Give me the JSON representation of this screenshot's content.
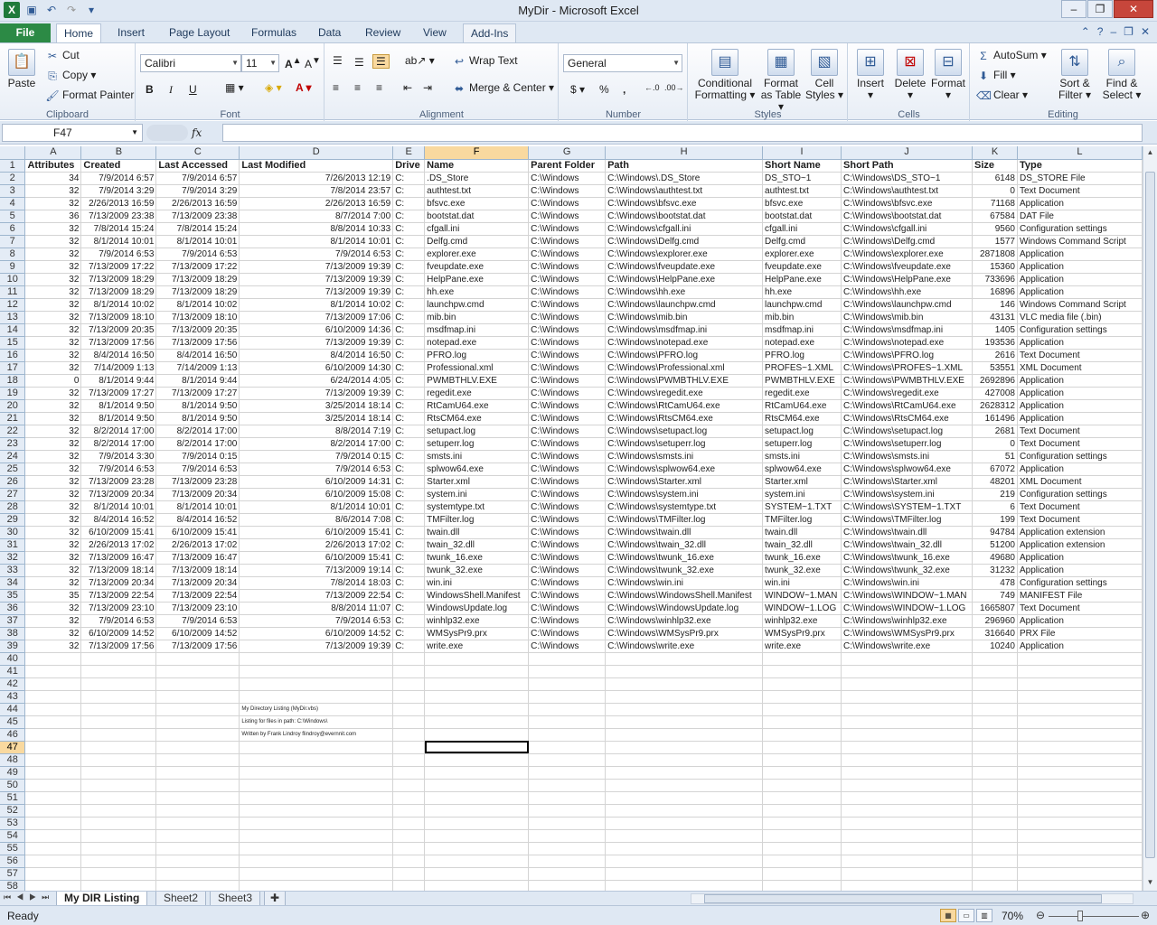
{
  "window": {
    "title": "MyDir  -  Microsoft Excel"
  },
  "ribbon_tabs": [
    "File",
    "Home",
    "Insert",
    "Page Layout",
    "Formulas",
    "Data",
    "Review",
    "View",
    "Add-Ins"
  ],
  "clipboard": {
    "paste": "Paste",
    "cut": "Cut",
    "copy": "Copy",
    "format_painter": "Format Painter",
    "label": "Clipboard"
  },
  "font": {
    "name": "Calibri",
    "size": "11",
    "bold": "B",
    "italic": "I",
    "underline": "U",
    "label": "Font"
  },
  "alignment": {
    "wrap_text": "Wrap Text",
    "merge_center": "Merge & Center",
    "label": "Alignment"
  },
  "number": {
    "format": "General",
    "currency": "$",
    "percent": "%",
    "comma": ",",
    "label": "Number"
  },
  "styles": {
    "conditional": "Conditional",
    "conditional2": "Formatting",
    "format_as": "Format",
    "format_as2": "as Table",
    "cell_styles": "Cell",
    "cell_styles2": "Styles",
    "label": "Styles"
  },
  "cells": {
    "insert": "Insert",
    "delete": "Delete",
    "format": "Format",
    "label": "Cells"
  },
  "editing": {
    "autosum": "AutoSum",
    "fill": "Fill",
    "clear": "Clear",
    "sort": "Sort &",
    "sort2": "Filter",
    "find": "Find &",
    "find2": "Select",
    "label": "Editing"
  },
  "formula_bar": {
    "name_box": "F47",
    "fx": "fx",
    "content": ""
  },
  "columns": [
    "A",
    "B",
    "C",
    "D",
    "E",
    "F",
    "G",
    "H",
    "I",
    "J",
    "K",
    "L"
  ],
  "selected_column": "F",
  "selected_row": 47,
  "headers": [
    "Attributes",
    "Created",
    "Last Accessed",
    "Last Modified",
    "Drive",
    "Name",
    "Parent Folder",
    "Path",
    "Short Name",
    "Short Path",
    "Size",
    "Type"
  ],
  "rows": [
    [
      "34",
      "7/9/2014 6:57",
      "7/9/2014 6:57",
      "7/26/2013 12:19",
      "C:",
      ".DS_Store",
      "C:\\Windows",
      "C:\\Windows\\.DS_Store",
      "DS_STO~1",
      "C:\\Windows\\DS_STO~1",
      "6148",
      "DS_STORE File"
    ],
    [
      "32",
      "7/9/2014 3:29",
      "7/9/2014 3:29",
      "7/8/2014 23:57",
      "C:",
      "authtest.txt",
      "C:\\Windows",
      "C:\\Windows\\authtest.txt",
      "authtest.txt",
      "C:\\Windows\\authtest.txt",
      "0",
      "Text Document"
    ],
    [
      "32",
      "2/26/2013 16:59",
      "2/26/2013 16:59",
      "2/26/2013 16:59",
      "C:",
      "bfsvc.exe",
      "C:\\Windows",
      "C:\\Windows\\bfsvc.exe",
      "bfsvc.exe",
      "C:\\Windows\\bfsvc.exe",
      "71168",
      "Application"
    ],
    [
      "36",
      "7/13/2009 23:38",
      "7/13/2009 23:38",
      "8/7/2014 7:00",
      "C:",
      "bootstat.dat",
      "C:\\Windows",
      "C:\\Windows\\bootstat.dat",
      "bootstat.dat",
      "C:\\Windows\\bootstat.dat",
      "67584",
      "DAT File"
    ],
    [
      "32",
      "7/8/2014 15:24",
      "7/8/2014 15:24",
      "8/8/2014 10:33",
      "C:",
      "cfgall.ini",
      "C:\\Windows",
      "C:\\Windows\\cfgall.ini",
      "cfgall.ini",
      "C:\\Windows\\cfgall.ini",
      "9560",
      "Configuration settings"
    ],
    [
      "32",
      "8/1/2014 10:01",
      "8/1/2014 10:01",
      "8/1/2014 10:01",
      "C:",
      "Delfg.cmd",
      "C:\\Windows",
      "C:\\Windows\\Delfg.cmd",
      "Delfg.cmd",
      "C:\\Windows\\Delfg.cmd",
      "1577",
      "Windows Command Script"
    ],
    [
      "32",
      "7/9/2014 6:53",
      "7/9/2014 6:53",
      "7/9/2014 6:53",
      "C:",
      "explorer.exe",
      "C:\\Windows",
      "C:\\Windows\\explorer.exe",
      "explorer.exe",
      "C:\\Windows\\explorer.exe",
      "2871808",
      "Application"
    ],
    [
      "32",
      "7/13/2009 17:22",
      "7/13/2009 17:22",
      "7/13/2009 19:39",
      "C:",
      "fveupdate.exe",
      "C:\\Windows",
      "C:\\Windows\\fveupdate.exe",
      "fveupdate.exe",
      "C:\\Windows\\fveupdate.exe",
      "15360",
      "Application"
    ],
    [
      "32",
      "7/13/2009 18:29",
      "7/13/2009 18:29",
      "7/13/2009 19:39",
      "C:",
      "HelpPane.exe",
      "C:\\Windows",
      "C:\\Windows\\HelpPane.exe",
      "HelpPane.exe",
      "C:\\Windows\\HelpPane.exe",
      "733696",
      "Application"
    ],
    [
      "32",
      "7/13/2009 18:29",
      "7/13/2009 18:29",
      "7/13/2009 19:39",
      "C:",
      "hh.exe",
      "C:\\Windows",
      "C:\\Windows\\hh.exe",
      "hh.exe",
      "C:\\Windows\\hh.exe",
      "16896",
      "Application"
    ],
    [
      "32",
      "8/1/2014 10:02",
      "8/1/2014 10:02",
      "8/1/2014 10:02",
      "C:",
      "launchpw.cmd",
      "C:\\Windows",
      "C:\\Windows\\launchpw.cmd",
      "launchpw.cmd",
      "C:\\Windows\\launchpw.cmd",
      "146",
      "Windows Command Script"
    ],
    [
      "32",
      "7/13/2009 18:10",
      "7/13/2009 18:10",
      "7/13/2009 17:06",
      "C:",
      "mib.bin",
      "C:\\Windows",
      "C:\\Windows\\mib.bin",
      "mib.bin",
      "C:\\Windows\\mib.bin",
      "43131",
      "VLC media file (.bin)"
    ],
    [
      "32",
      "7/13/2009 20:35",
      "7/13/2009 20:35",
      "6/10/2009 14:36",
      "C:",
      "msdfmap.ini",
      "C:\\Windows",
      "C:\\Windows\\msdfmap.ini",
      "msdfmap.ini",
      "C:\\Windows\\msdfmap.ini",
      "1405",
      "Configuration settings"
    ],
    [
      "32",
      "7/13/2009 17:56",
      "7/13/2009 17:56",
      "7/13/2009 19:39",
      "C:",
      "notepad.exe",
      "C:\\Windows",
      "C:\\Windows\\notepad.exe",
      "notepad.exe",
      "C:\\Windows\\notepad.exe",
      "193536",
      "Application"
    ],
    [
      "32",
      "8/4/2014 16:50",
      "8/4/2014 16:50",
      "8/4/2014 16:50",
      "C:",
      "PFRO.log",
      "C:\\Windows",
      "C:\\Windows\\PFRO.log",
      "PFRO.log",
      "C:\\Windows\\PFRO.log",
      "2616",
      "Text Document"
    ],
    [
      "32",
      "7/14/2009 1:13",
      "7/14/2009 1:13",
      "6/10/2009 14:30",
      "C:",
      "Professional.xml",
      "C:\\Windows",
      "C:\\Windows\\Professional.xml",
      "PROFES~1.XML",
      "C:\\Windows\\PROFES~1.XML",
      "53551",
      "XML Document"
    ],
    [
      "0",
      "8/1/2014 9:44",
      "8/1/2014 9:44",
      "6/24/2014 4:05",
      "C:",
      "PWMBTHLV.EXE",
      "C:\\Windows",
      "C:\\Windows\\PWMBTHLV.EXE",
      "PWMBTHLV.EXE",
      "C:\\Windows\\PWMBTHLV.EXE",
      "2692896",
      "Application"
    ],
    [
      "32",
      "7/13/2009 17:27",
      "7/13/2009 17:27",
      "7/13/2009 19:39",
      "C:",
      "regedit.exe",
      "C:\\Windows",
      "C:\\Windows\\regedit.exe",
      "regedit.exe",
      "C:\\Windows\\regedit.exe",
      "427008",
      "Application"
    ],
    [
      "32",
      "8/1/2014 9:50",
      "8/1/2014 9:50",
      "3/25/2014 18:14",
      "C:",
      "RtCamU64.exe",
      "C:\\Windows",
      "C:\\Windows\\RtCamU64.exe",
      "RtCamU64.exe",
      "C:\\Windows\\RtCamU64.exe",
      "2628312",
      "Application"
    ],
    [
      "32",
      "8/1/2014 9:50",
      "8/1/2014 9:50",
      "3/25/2014 18:14",
      "C:",
      "RtsCM64.exe",
      "C:\\Windows",
      "C:\\Windows\\RtsCM64.exe",
      "RtsCM64.exe",
      "C:\\Windows\\RtsCM64.exe",
      "161496",
      "Application"
    ],
    [
      "32",
      "8/2/2014 17:00",
      "8/2/2014 17:00",
      "8/8/2014 7:19",
      "C:",
      "setupact.log",
      "C:\\Windows",
      "C:\\Windows\\setupact.log",
      "setupact.log",
      "C:\\Windows\\setupact.log",
      "2681",
      "Text Document"
    ],
    [
      "32",
      "8/2/2014 17:00",
      "8/2/2014 17:00",
      "8/2/2014 17:00",
      "C:",
      "setuperr.log",
      "C:\\Windows",
      "C:\\Windows\\setuperr.log",
      "setuperr.log",
      "C:\\Windows\\setuperr.log",
      "0",
      "Text Document"
    ],
    [
      "32",
      "7/9/2014 3:30",
      "7/9/2014 0:15",
      "7/9/2014 0:15",
      "C:",
      "smsts.ini",
      "C:\\Windows",
      "C:\\Windows\\smsts.ini",
      "smsts.ini",
      "C:\\Windows\\smsts.ini",
      "51",
      "Configuration settings"
    ],
    [
      "32",
      "7/9/2014 6:53",
      "7/9/2014 6:53",
      "7/9/2014 6:53",
      "C:",
      "splwow64.exe",
      "C:\\Windows",
      "C:\\Windows\\splwow64.exe",
      "splwow64.exe",
      "C:\\Windows\\splwow64.exe",
      "67072",
      "Application"
    ],
    [
      "32",
      "7/13/2009 23:28",
      "7/13/2009 23:28",
      "6/10/2009 14:31",
      "C:",
      "Starter.xml",
      "C:\\Windows",
      "C:\\Windows\\Starter.xml",
      "Starter.xml",
      "C:\\Windows\\Starter.xml",
      "48201",
      "XML Document"
    ],
    [
      "32",
      "7/13/2009 20:34",
      "7/13/2009 20:34",
      "6/10/2009 15:08",
      "C:",
      "system.ini",
      "C:\\Windows",
      "C:\\Windows\\system.ini",
      "system.ini",
      "C:\\Windows\\system.ini",
      "219",
      "Configuration settings"
    ],
    [
      "32",
      "8/1/2014 10:01",
      "8/1/2014 10:01",
      "8/1/2014 10:01",
      "C:",
      "systemtype.txt",
      "C:\\Windows",
      "C:\\Windows\\systemtype.txt",
      "SYSTEM~1.TXT",
      "C:\\Windows\\SYSTEM~1.TXT",
      "6",
      "Text Document"
    ],
    [
      "32",
      "8/4/2014 16:52",
      "8/4/2014 16:52",
      "8/6/2014 7:08",
      "C:",
      "TMFilter.log",
      "C:\\Windows",
      "C:\\Windows\\TMFilter.log",
      "TMFilter.log",
      "C:\\Windows\\TMFilter.log",
      "199",
      "Text Document"
    ],
    [
      "32",
      "6/10/2009 15:41",
      "6/10/2009 15:41",
      "6/10/2009 15:41",
      "C:",
      "twain.dll",
      "C:\\Windows",
      "C:\\Windows\\twain.dll",
      "twain.dll",
      "C:\\Windows\\twain.dll",
      "94784",
      "Application extension"
    ],
    [
      "32",
      "2/26/2013 17:02",
      "2/26/2013 17:02",
      "2/26/2013 17:02",
      "C:",
      "twain_32.dll",
      "C:\\Windows",
      "C:\\Windows\\twain_32.dll",
      "twain_32.dll",
      "C:\\Windows\\twain_32.dll",
      "51200",
      "Application extension"
    ],
    [
      "32",
      "7/13/2009 16:47",
      "7/13/2009 16:47",
      "6/10/2009 15:41",
      "C:",
      "twunk_16.exe",
      "C:\\Windows",
      "C:\\Windows\\twunk_16.exe",
      "twunk_16.exe",
      "C:\\Windows\\twunk_16.exe",
      "49680",
      "Application"
    ],
    [
      "32",
      "7/13/2009 18:14",
      "7/13/2009 18:14",
      "7/13/2009 19:14",
      "C:",
      "twunk_32.exe",
      "C:\\Windows",
      "C:\\Windows\\twunk_32.exe",
      "twunk_32.exe",
      "C:\\Windows\\twunk_32.exe",
      "31232",
      "Application"
    ],
    [
      "32",
      "7/13/2009 20:34",
      "7/13/2009 20:34",
      "7/8/2014 18:03",
      "C:",
      "win.ini",
      "C:\\Windows",
      "C:\\Windows\\win.ini",
      "win.ini",
      "C:\\Windows\\win.ini",
      "478",
      "Configuration settings"
    ],
    [
      "35",
      "7/13/2009 22:54",
      "7/13/2009 22:54",
      "7/13/2009 22:54",
      "C:",
      "WindowsShell.Manifest",
      "C:\\Windows",
      "C:\\Windows\\WindowsShell.Manifest",
      "WINDOW~1.MAN",
      "C:\\Windows\\WINDOW~1.MAN",
      "749",
      "MANIFEST File"
    ],
    [
      "32",
      "7/13/2009 23:10",
      "7/13/2009 23:10",
      "8/8/2014 11:07",
      "C:",
      "WindowsUpdate.log",
      "C:\\Windows",
      "C:\\Windows\\WindowsUpdate.log",
      "WINDOW~1.LOG",
      "C:\\Windows\\WINDOW~1.LOG",
      "1665807",
      "Text Document"
    ],
    [
      "32",
      "7/9/2014 6:53",
      "7/9/2014 6:53",
      "7/9/2014 6:53",
      "C:",
      "winhlp32.exe",
      "C:\\Windows",
      "C:\\Windows\\winhlp32.exe",
      "winhlp32.exe",
      "C:\\Windows\\winhlp32.exe",
      "296960",
      "Application"
    ],
    [
      "32",
      "6/10/2009 14:52",
      "6/10/2009 14:52",
      "6/10/2009 14:52",
      "C:",
      "WMSysPr9.prx",
      "C:\\Windows",
      "C:\\Windows\\WMSysPr9.prx",
      "WMSysPr9.prx",
      "C:\\Windows\\WMSysPr9.prx",
      "316640",
      "PRX File"
    ],
    [
      "32",
      "7/13/2009 17:56",
      "7/13/2009 17:56",
      "7/13/2009 19:39",
      "C:",
      "write.exe",
      "C:\\Windows",
      "C:\\Windows\\write.exe",
      "write.exe",
      "C:\\Windows\\write.exe",
      "10240",
      "Application"
    ]
  ],
  "notes": {
    "44": "My Directory Listing (MyDir.vbs)",
    "45": "Listing for files in path: C:\\Windows\\",
    "46": "Written by Frank Lindroy flindroy@evernnit.com"
  },
  "row_count": 58,
  "sheet_tabs": [
    "My DIR Listing",
    "Sheet2",
    "Sheet3"
  ],
  "active_sheet": "My DIR Listing",
  "status": {
    "ready": "Ready",
    "zoom": "70%",
    "zoom_level_percent": 70
  },
  "colors": {
    "file_tab": "#2c8a45",
    "selected_header": "#f9d99f",
    "ribbon_bg": "#dfe8f3"
  }
}
